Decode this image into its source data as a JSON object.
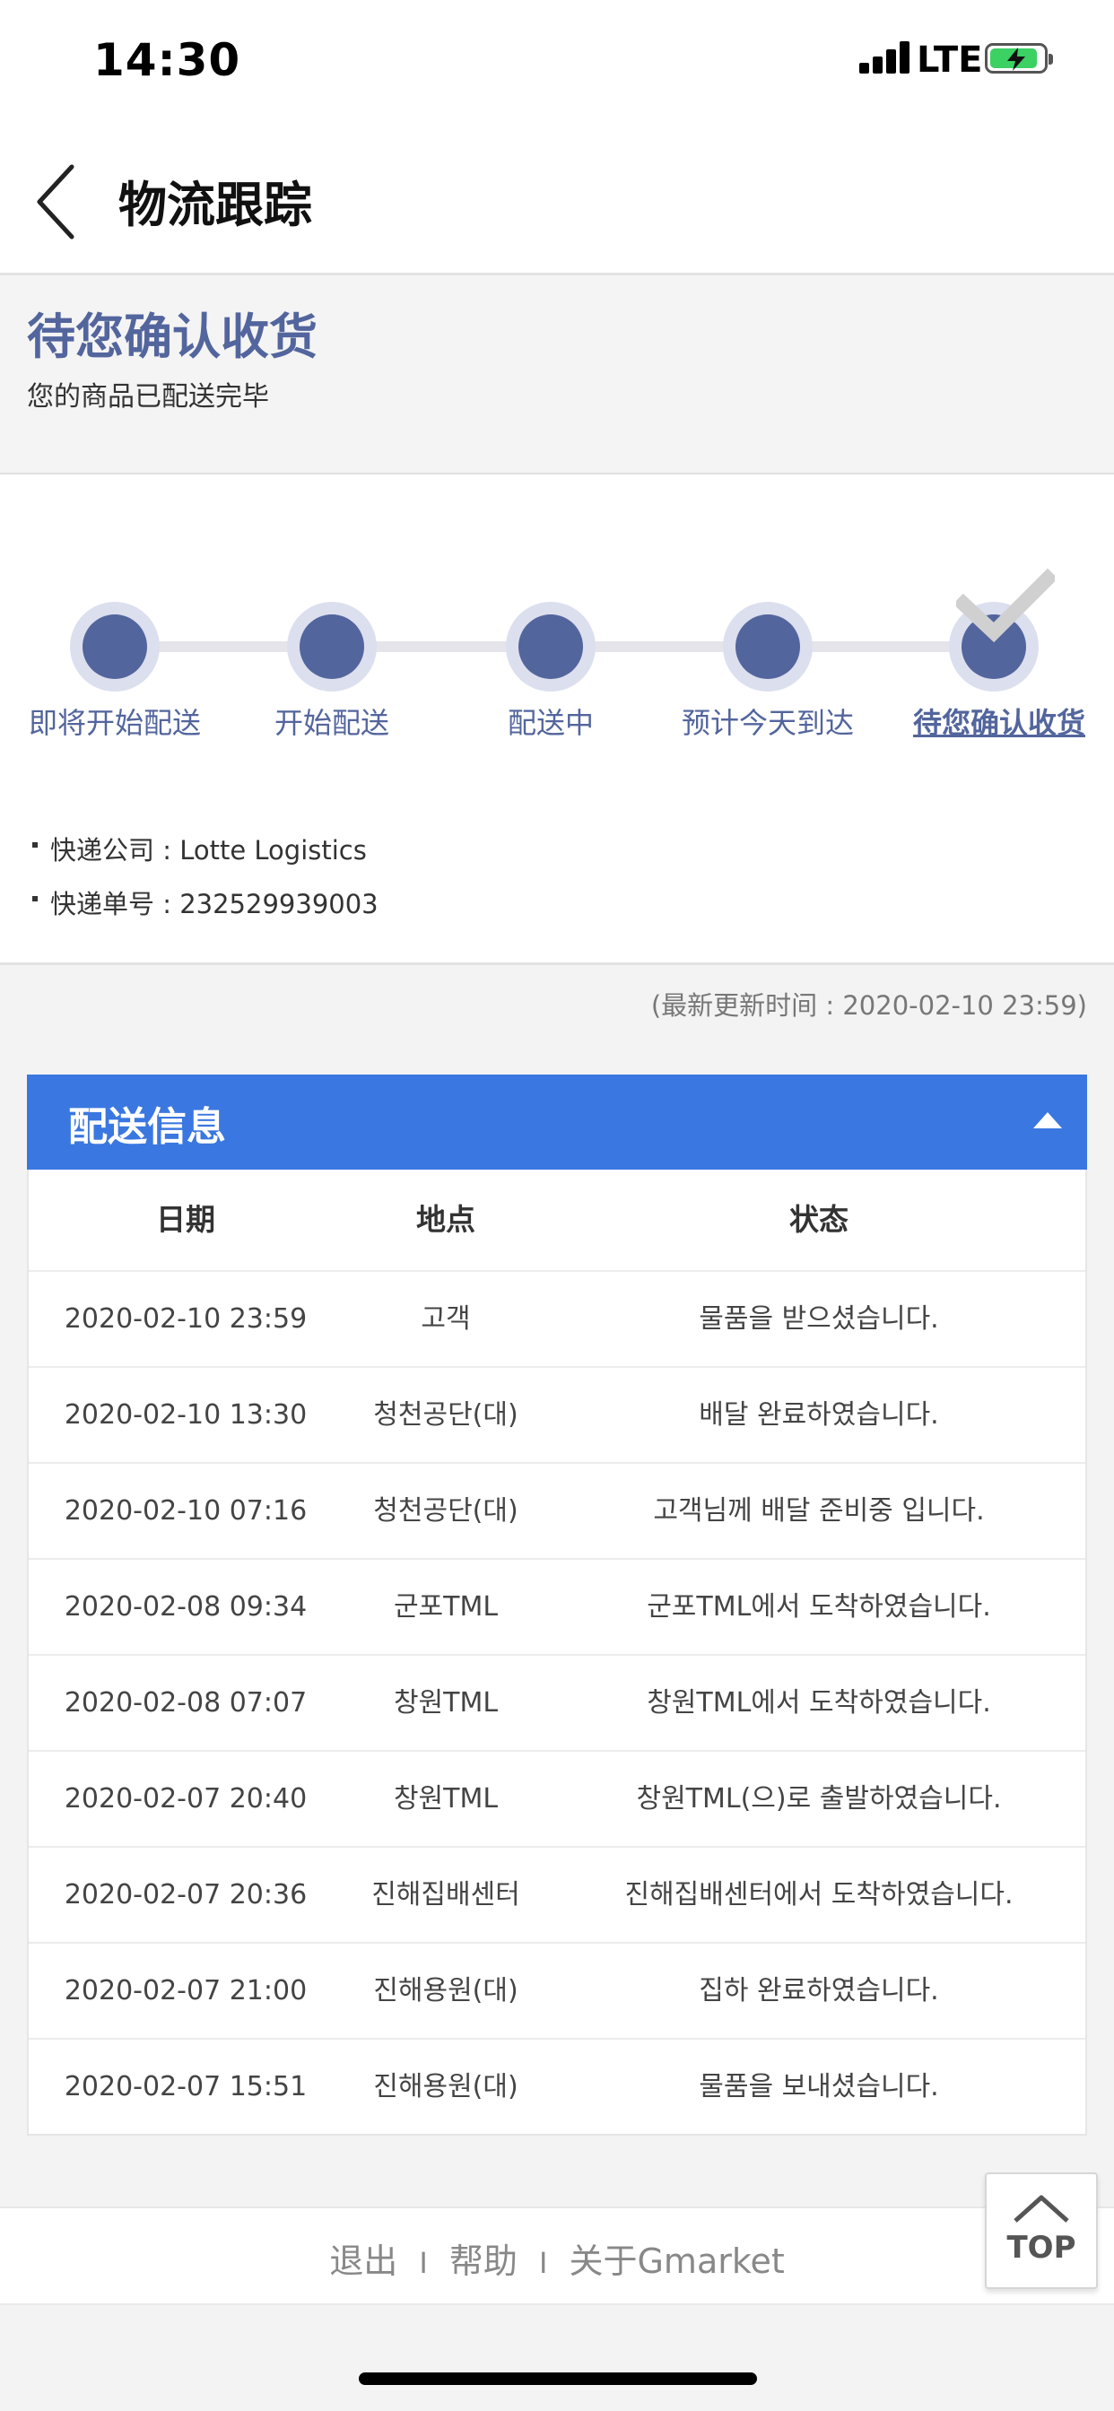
{
  "status_bar": {
    "time": "14:30",
    "network": "LTE"
  },
  "header": {
    "title": "物流跟踪"
  },
  "summary": {
    "title": "待您确认收货",
    "subtitle": "您的商品已配送完毕"
  },
  "progress": {
    "steps": [
      {
        "label": "即将开始配送"
      },
      {
        "label": "开始配送"
      },
      {
        "label": "配送中"
      },
      {
        "label": "预计今天到达"
      },
      {
        "label": "待您确认收货"
      }
    ],
    "current_step": 5
  },
  "shipment": {
    "company_label": "快递公司 : Lotte Logistics",
    "tracking_label": "快递单号 : 232529939003"
  },
  "last_updated": "(最新更新时间 : 2020-02-10 23:59)",
  "delivery": {
    "title": "配送信息",
    "columns": [
      "日期",
      "地点",
      "状态"
    ],
    "rows": [
      {
        "date": "2020-02-10 23:59",
        "location": "고객",
        "status": "물품을 받으셨습니다."
      },
      {
        "date": "2020-02-10 13:30",
        "location": "청천공단(대)",
        "status": "배달 완료하였습니다."
      },
      {
        "date": "2020-02-10 07:16",
        "location": "청천공단(대)",
        "status": "고객님께 배달 준비중 입니다."
      },
      {
        "date": "2020-02-08 09:34",
        "location": "군포TML",
        "status": "군포TML에서 도착하였습니다."
      },
      {
        "date": "2020-02-08 07:07",
        "location": "창원TML",
        "status": "창원TML에서 도착하였습니다."
      },
      {
        "date": "2020-02-07 20:40",
        "location": "창원TML",
        "status": "창원TML(으)로 출발하였습니다."
      },
      {
        "date": "2020-02-07 20:36",
        "location": "진해집배센터",
        "status": "진해집배센터에서 도착하였습니다."
      },
      {
        "date": "2020-02-07 21:00",
        "location": "진해용원(대)",
        "status": "집하 완료하였습니다."
      },
      {
        "date": "2020-02-07 15:51",
        "location": "진해용원(대)",
        "status": "물품을 보내셨습니다."
      }
    ]
  },
  "footer": {
    "links": [
      "退出",
      "帮助",
      "关于Gmarket"
    ],
    "separator": "I"
  },
  "top_button": {
    "label": "TOP"
  },
  "colors": {
    "brand_text": "#53659d",
    "header_blue": "#3a77e0",
    "step_ring": "#dcdfee"
  }
}
